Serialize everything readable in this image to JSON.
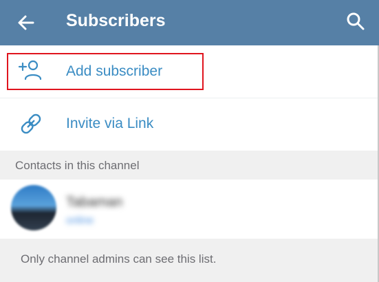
{
  "header": {
    "title": "Subscribers",
    "back_icon": "arrow-left-icon",
    "search_icon": "search-icon",
    "background_color": "#5680a6"
  },
  "actions": [
    {
      "label": "Add subscriber",
      "icon": "add-person-icon",
      "highlighted": true
    },
    {
      "label": "Invite via Link",
      "icon": "link-icon",
      "highlighted": false
    }
  ],
  "section": {
    "title": "Contacts in this channel"
  },
  "contacts": [
    {
      "name": "Tabaman",
      "status": "online",
      "blurred": true
    }
  ],
  "footer": {
    "text": "Only channel admins can see this list."
  },
  "colors": {
    "accent": "#3a8cc3",
    "highlight": "#e0141e"
  }
}
